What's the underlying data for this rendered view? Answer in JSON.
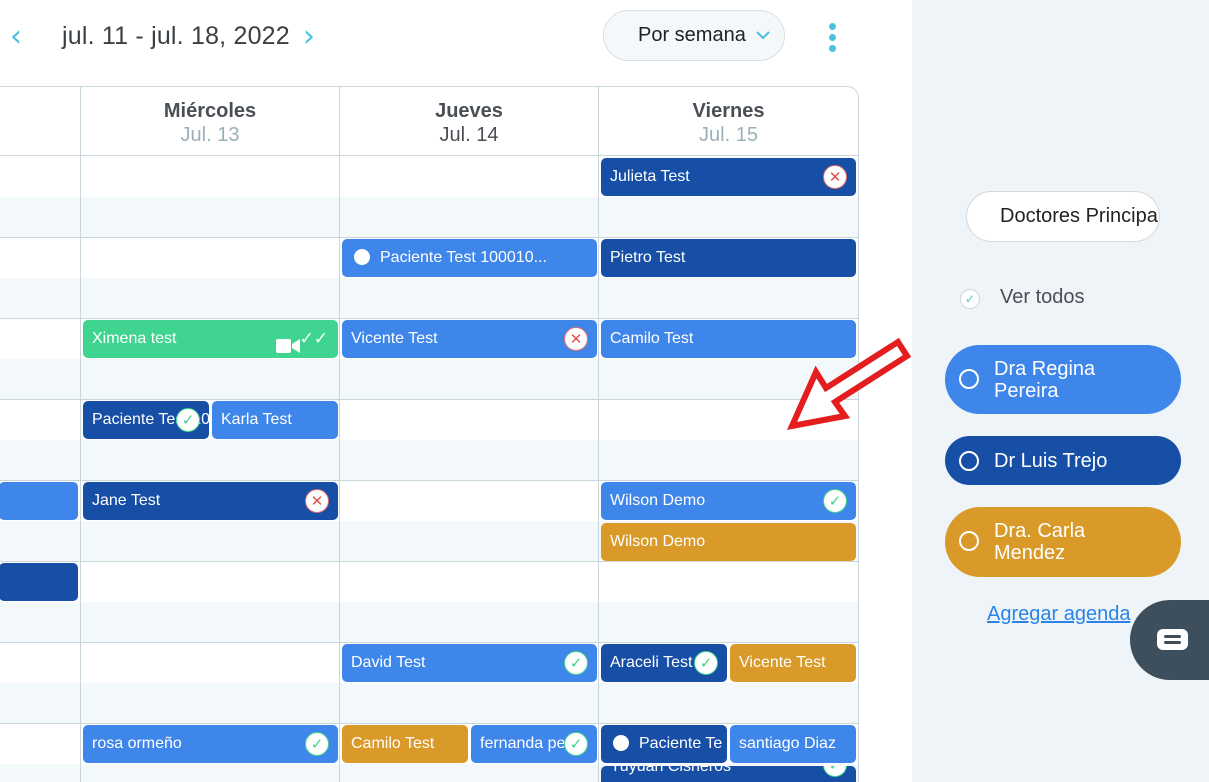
{
  "toolbar": {
    "prev_glyph": "‹",
    "next_glyph": "›",
    "date_range": "jul. 11 - jul. 18, 2022",
    "view_selected": "Por semana"
  },
  "days": [
    {
      "name": "Miércoles",
      "date": "Jul. 13"
    },
    {
      "name": "Jueves",
      "date": "Jul. 14"
    },
    {
      "name": "Viernes",
      "date": "Jul. 15"
    }
  ],
  "events": {
    "julieta": "Julieta Test",
    "paciente_thu": "Paciente Test 100010...",
    "pietro": "Pietro Test",
    "ximena": "Ximena test",
    "vicente_thu": "Vicente Test",
    "camilo_fri": "Camilo Test",
    "paciente_wed": "Paciente Test 10",
    "karla": "Karla Test",
    "jane": "Jane Test",
    "wilson_1": "Wilson Demo",
    "wilson_2": "Wilson Demo",
    "david": "David Test",
    "araceli": "Araceli Test",
    "vicente_fri": "Vicente Test",
    "rosa": "rosa ormeño",
    "camilo_thu": "Camilo Test",
    "fernanda": "fernanda pe",
    "paciente_fri": "Paciente Te",
    "santiago": "santiago Diaz",
    "yuyuan": "Yuyuan Cisneros"
  },
  "status_glyphs": {
    "confirmed": "✓",
    "cancelled": "✕",
    "double_check": "✓✓"
  },
  "sidebar": {
    "doctor_select": "Doctores Principales",
    "check_glyph": "✓",
    "see_all": "Ver todos",
    "doctors": [
      {
        "line1": "Dra Regina",
        "line2": "Pereira",
        "color": "#3f86ea"
      },
      {
        "line1": "Dr Luis Trejo",
        "line2": "",
        "color": "#174ea6"
      },
      {
        "line1": "Dra. Carla",
        "line2": "Mendez",
        "color": "#d99a29"
      }
    ],
    "add_agenda": "Agregar agenda"
  },
  "colors": {
    "accent": "#49c3dd",
    "annotation": "#e41e1e"
  }
}
